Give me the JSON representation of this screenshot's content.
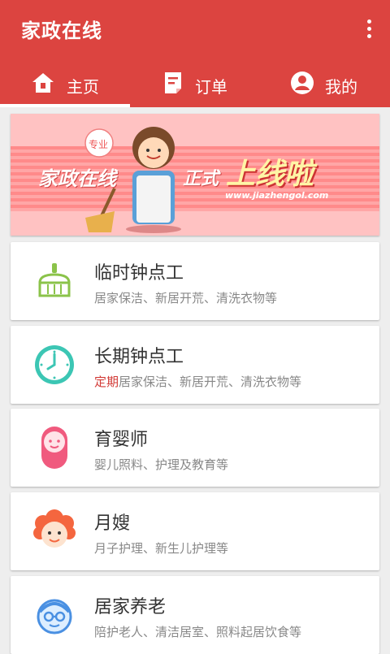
{
  "app": {
    "title": "家政在线"
  },
  "tabs": [
    {
      "label": "主页",
      "icon": "home-icon",
      "active": true
    },
    {
      "label": "订单",
      "icon": "order-icon",
      "active": false
    },
    {
      "label": "我的",
      "icon": "account-icon",
      "active": false
    }
  ],
  "banner": {
    "badge": "专业",
    "left_text": "家政在线",
    "mid_text": "正式",
    "big_text": "上线啦",
    "url": "www.jiazhengol.com"
  },
  "services": [
    {
      "title": "临时钟点工",
      "subtitle_highlight": "",
      "subtitle": "居家保洁、新居开荒、清洗衣物等",
      "icon": "broom-icon",
      "color": "#8bc34a"
    },
    {
      "title": "长期钟点工",
      "subtitle_highlight": "定期",
      "subtitle": "居家保洁、新居开荒、清洗衣物等",
      "icon": "clock-icon",
      "color": "#3cc6b4"
    },
    {
      "title": "育婴师",
      "subtitle_highlight": "",
      "subtitle": "婴儿照料、护理及教育等",
      "icon": "baby-icon",
      "color": "#f05a7e"
    },
    {
      "title": "月嫂",
      "subtitle_highlight": "",
      "subtitle": "月子护理、新生儿护理等",
      "icon": "nanny-icon",
      "color": "#f4663f"
    },
    {
      "title": "居家养老",
      "subtitle_highlight": "",
      "subtitle": "陪护老人、清洁居室、照料起居饮食等",
      "icon": "elderly-icon",
      "color": "#4a90e2"
    }
  ]
}
